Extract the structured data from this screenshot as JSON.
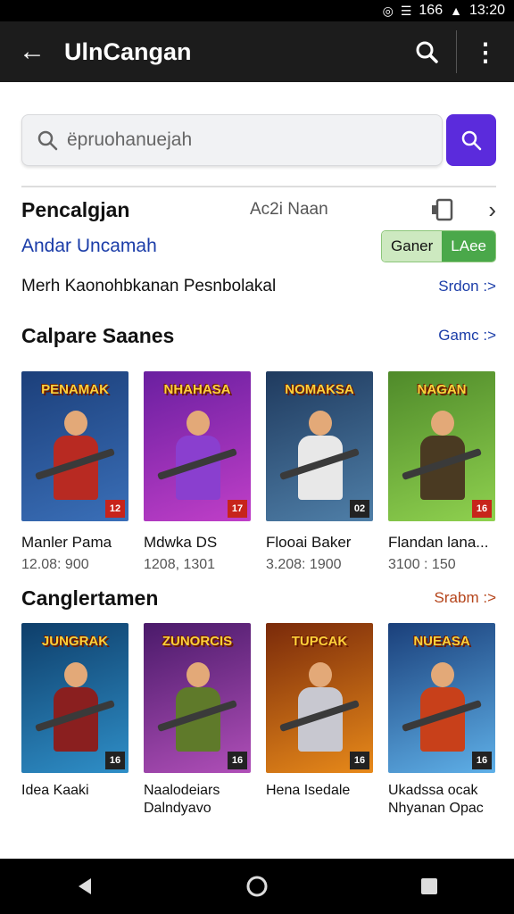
{
  "status_bar": {
    "signal_text": "166",
    "time": "13:20"
  },
  "app_bar": {
    "title": "UlnCangan"
  },
  "search": {
    "placeholder": "ëpruohanuejah"
  },
  "summary": {
    "title": "Pencalgjan",
    "count": "Ac2i Naan",
    "link": "Andar Uncamah",
    "toggle_left": "Ganer",
    "toggle_right": "LAee",
    "description": "Merh Kaonohbkanan Pesnbolakal",
    "more_link": "Srdon :>"
  },
  "section1": {
    "title": "Calpare Saanes",
    "link": "Gamc :>",
    "games": [
      {
        "logo": "PENAMAK",
        "name": "Manler Pama",
        "meta": "12.08: 900",
        "colors": [
          "#1c3f7a",
          "#3a6fb8"
        ],
        "body": "#b82a22",
        "badge": "12",
        "badge_color": "#c7241b"
      },
      {
        "logo": "NHAHASA",
        "name": "Mdwka DS",
        "meta": "1208, 1301",
        "colors": [
          "#6a1fa0",
          "#c03fc8"
        ],
        "body": "#8a3fcf",
        "badge": "17",
        "badge_color": "#c7241b"
      },
      {
        "logo": "NOMAKSA",
        "name": "Flooai Baker",
        "meta": "3.208: 1900",
        "colors": [
          "#1f3a5e",
          "#4f7fa8"
        ],
        "body": "#e8e8e8",
        "badge": "02",
        "badge_color": "#222222"
      },
      {
        "logo": "NAGAN",
        "name": "Flandan lana...",
        "meta": "3100 : 150",
        "colors": [
          "#4f8a2a",
          "#8fd14f"
        ],
        "body": "#4a3a22",
        "badge": "16",
        "badge_color": "#c7241b"
      }
    ]
  },
  "section2": {
    "title": "Canglertamen",
    "link": "Srabm :>",
    "games": [
      {
        "logo": "JUNGRAK",
        "name": "Idea Kaaki",
        "colors": [
          "#0e3e6a",
          "#2f8fc8"
        ],
        "body": "#8a1f1f",
        "badge": "16",
        "badge_color": "#222222"
      },
      {
        "logo": "ZUNORCIS",
        "name": "Naalodeiars Dalndyavo",
        "colors": [
          "#4a1a6a",
          "#b04fb8"
        ],
        "body": "#5f7a2a",
        "badge": "16",
        "badge_color": "#222222"
      },
      {
        "logo": "TUPCAK",
        "name": "Hena Isedale",
        "colors": [
          "#7a2a0a",
          "#e88a1a"
        ],
        "body": "#c8c8d0",
        "badge": "16",
        "badge_color": "#222222"
      },
      {
        "logo": "NUEASA",
        "name": "Ukadssa ocak Nhyanan Opac",
        "colors": [
          "#1a3f7a",
          "#5fb0e8"
        ],
        "body": "#c8401a",
        "badge": "16",
        "badge_color": "#222222"
      }
    ]
  }
}
